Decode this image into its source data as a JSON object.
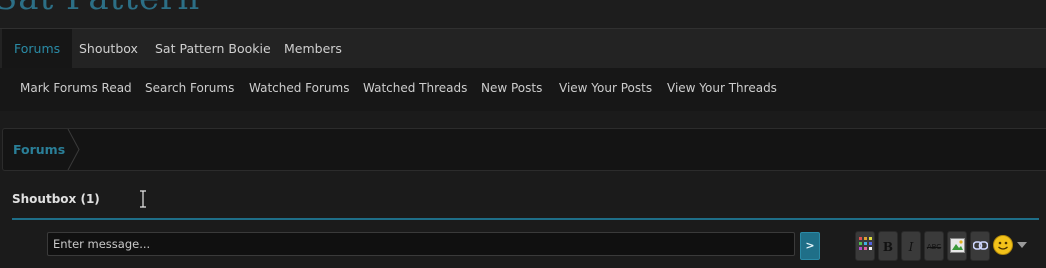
{
  "site": {
    "logo_text": "Sat Pattern"
  },
  "nav": {
    "tabs": [
      {
        "label": "Forums",
        "active": true
      },
      {
        "label": "Shoutbox",
        "active": false
      },
      {
        "label": "Sat Pattern Bookie",
        "active": false
      },
      {
        "label": "Members",
        "active": false
      }
    ]
  },
  "subnav": {
    "links": [
      {
        "label": "Mark Forums Read"
      },
      {
        "label": "Search Forums"
      },
      {
        "label": "Watched Forums"
      },
      {
        "label": "Watched Threads"
      },
      {
        "label": "New Posts"
      },
      {
        "label": "View Your Posts"
      },
      {
        "label": "View Your Threads"
      }
    ]
  },
  "breadcrumb": {
    "items": [
      {
        "label": "Forums"
      }
    ]
  },
  "shoutbox": {
    "title": "Shoutbox (1)",
    "input_placeholder": "Enter message...",
    "send_label": ">",
    "toolbar": [
      {
        "name": "color-palette-icon",
        "glyph": ""
      },
      {
        "name": "bold-icon",
        "glyph": "B"
      },
      {
        "name": "italic-icon",
        "glyph": "I"
      },
      {
        "name": "strikethrough-icon",
        "glyph": "ABC"
      },
      {
        "name": "insert-image-icon",
        "glyph": ""
      },
      {
        "name": "insert-link-icon",
        "glyph": ""
      }
    ]
  },
  "colors": {
    "accent": "#2a8ba6",
    "background": "#1b1b1b",
    "rule": "#1e6e88"
  }
}
